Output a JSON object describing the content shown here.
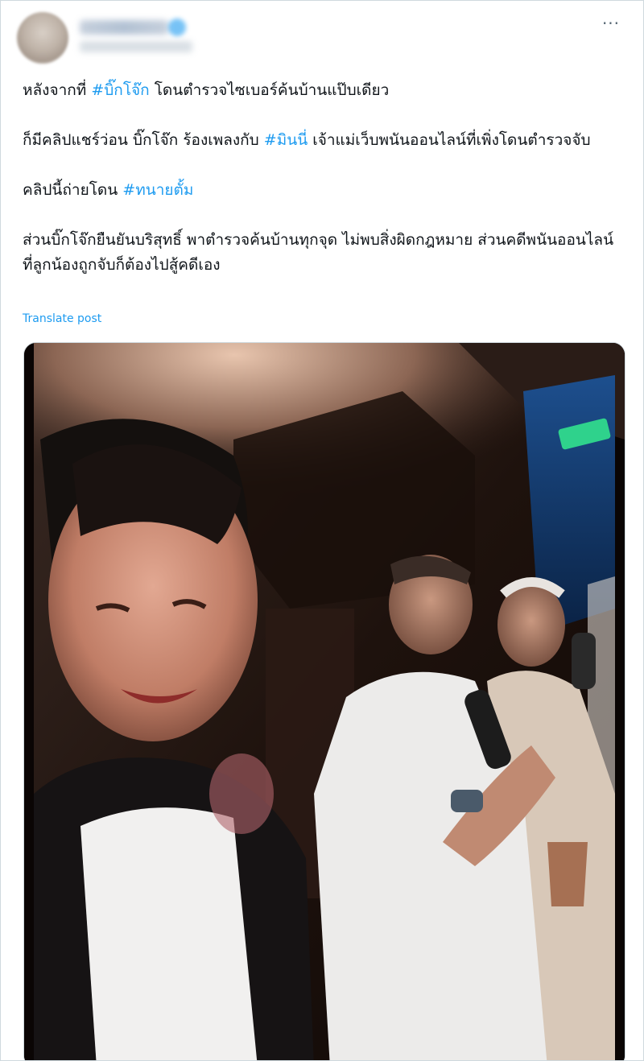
{
  "post": {
    "more_label": "···",
    "paragraphs": [
      {
        "before": "หลังจากที่ ",
        "hashtag": "#บิ๊กโจ๊ก",
        "after": " โดนตำรวจไซเบอร์ค้นบ้านแป๊บเดียว"
      },
      {
        "before": "ก็มีคลิปแชร์ว่อน บิ๊กโจ๊ก ร้องเพลงกับ ",
        "hashtag": "#มินนี่",
        "after": " เจ้าแม่เว็บพนันออนไลน์ที่เพิ่งโดนตำรวจจับ"
      },
      {
        "before": "คลิปนี้ถ่ายโดน ",
        "hashtag": "#ทนายตั้ม",
        "after": ""
      },
      {
        "text": "ส่วนบิ๊กโจ๊กยืนยันบริสุทธิ์ พาตำรวจค้นบ้านทุกจุด ไม่พบสิ่งผิดกฎหมาย ส่วนคดีพนันออนไลน์ที่ลูกน้องถูกจับก็ต้องไปสู้คดีเอง"
      }
    ],
    "translate_label": "Translate post"
  },
  "colors": {
    "link": "#1d9bf0",
    "text": "#0f1419",
    "muted": "#536471",
    "border": "#cfd9de"
  },
  "icons": {
    "more": "more-horizontal-icon",
    "verified": "verified-badge-icon",
    "exit_sign": "exit-sign-icon"
  }
}
